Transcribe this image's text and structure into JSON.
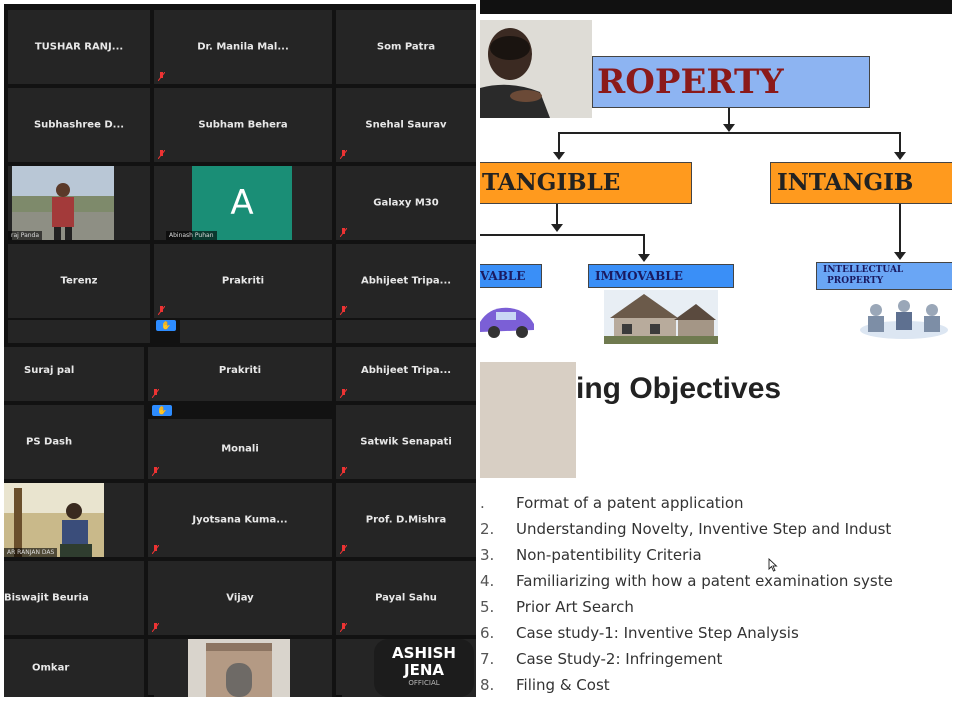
{
  "top_panel": {
    "participants": [
      {
        "name": "TUSHAR RANJ..."
      },
      {
        "name": "Dr. Manila Mal..."
      },
      {
        "name": "Som Patra"
      },
      {
        "name": "Subhashree D..."
      },
      {
        "name": "Subham Behera"
      },
      {
        "name": "Snehal Saurav"
      },
      {
        "name": "raj Panda"
      },
      {
        "name": "Abinash Puhan",
        "avatar_letter": "A"
      },
      {
        "name": "Galaxy M30"
      },
      {
        "name": "Terenz"
      },
      {
        "name": "Prakriti"
      },
      {
        "name": "Abhijeet Tripa..."
      }
    ]
  },
  "bottom_panel": {
    "participants": [
      {
        "name": "Suraj pal"
      },
      {
        "name": "Prakriti"
      },
      {
        "name": "Abhijeet Tripa..."
      },
      {
        "name": "PS Dash"
      },
      {
        "name": "Monali"
      },
      {
        "name": "Satwik Senapati"
      },
      {
        "name": "AR RANJAN DAS"
      },
      {
        "name": "Jyotsana Kuma..."
      },
      {
        "name": "Prof. D.Mishra"
      },
      {
        "name": "Biswajit Beuria"
      },
      {
        "name": "Vijay"
      },
      {
        "name": "Payal Sahu"
      },
      {
        "name": "Omkar"
      },
      {
        "name": ""
      },
      {
        "name": "",
        "logo_text": "ASHISH JENA",
        "logo_sub": "OFFICIAL"
      }
    ]
  },
  "slide1": {
    "title": "ROPERTY",
    "tangible": "TANGIBLE",
    "intangible": "INTANGIB",
    "movable": "VABLE",
    "immovable": "IMMOVABLE",
    "intellectual_line1": "INTELLECTUAL",
    "intellectual_line2": "PROPERTY"
  },
  "slide2": {
    "title": "ing Objectives",
    "items": [
      {
        "num": ".",
        "text": "Format of a patent application"
      },
      {
        "num": "2.",
        "text": "Understanding Novelty, Inventive Step and Indust"
      },
      {
        "num": "3.",
        "text": "Non-patentibility Criteria"
      },
      {
        "num": "4.",
        "text": "Familiarizing with how a patent examination syste"
      },
      {
        "num": "5.",
        "text": "Prior Art Search"
      },
      {
        "num": "6.",
        "text": "Case study-1: Inventive Step Analysis"
      },
      {
        "num": "7.",
        "text": "Case Study-2: Infringement"
      },
      {
        "num": "8.",
        "text": "Filing & Cost"
      }
    ]
  },
  "colors": {
    "tile_bg": "#252525",
    "panel_bg": "#121212",
    "hand_blue": "#2d8cff",
    "property_box": "#8db4f2",
    "tangible_box": "#ff9a1e",
    "immovable_box": "#3a8ff7",
    "title_red": "#8b1a1a",
    "avatar_green": "#1a8e76"
  }
}
